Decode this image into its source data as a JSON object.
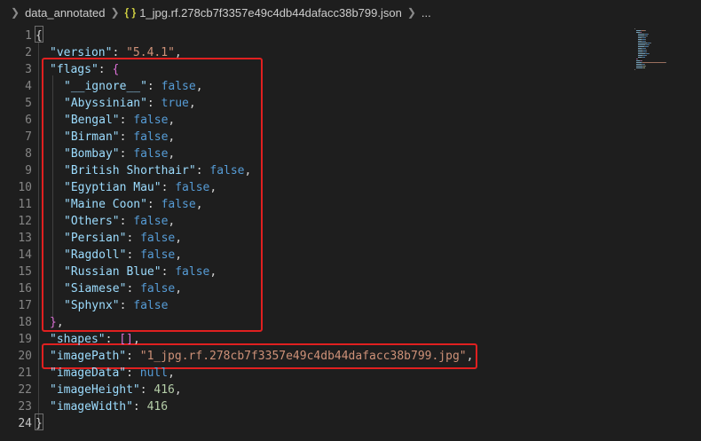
{
  "breadcrumb": {
    "folder": "data_annotated",
    "file_icon": "{ }",
    "file": "1_jpg.rf.278cb7f3357e49c4db44dafacc38b799.json",
    "more": "..."
  },
  "editor": {
    "line_numbers": [
      "1",
      "2",
      "3",
      "4",
      "5",
      "6",
      "7",
      "8",
      "9",
      "10",
      "11",
      "12",
      "13",
      "14",
      "15",
      "16",
      "17",
      "18",
      "19",
      "20",
      "21",
      "22",
      "23",
      "24"
    ],
    "active_line": "24",
    "lines": [
      [
        {
          "t": "p",
          "v": "{"
        }
      ],
      [
        {
          "t": "k",
          "v": "\"version\""
        },
        {
          "t": "p",
          "v": ": "
        },
        {
          "t": "s",
          "v": "\"5.4.1\""
        },
        {
          "t": "p",
          "v": ","
        }
      ],
      [
        {
          "t": "k",
          "v": "\"flags\""
        },
        {
          "t": "p",
          "v": ": "
        },
        {
          "t": "m",
          "v": "{"
        }
      ],
      [
        {
          "t": "k",
          "v": "\"__ignore__\""
        },
        {
          "t": "p",
          "v": ": "
        },
        {
          "t": "b",
          "v": "false"
        },
        {
          "t": "p",
          "v": ","
        }
      ],
      [
        {
          "t": "k",
          "v": "\"Abyssinian\""
        },
        {
          "t": "p",
          "v": ": "
        },
        {
          "t": "b",
          "v": "true"
        },
        {
          "t": "p",
          "v": ","
        }
      ],
      [
        {
          "t": "k",
          "v": "\"Bengal\""
        },
        {
          "t": "p",
          "v": ": "
        },
        {
          "t": "b",
          "v": "false"
        },
        {
          "t": "p",
          "v": ","
        }
      ],
      [
        {
          "t": "k",
          "v": "\"Birman\""
        },
        {
          "t": "p",
          "v": ": "
        },
        {
          "t": "b",
          "v": "false"
        },
        {
          "t": "p",
          "v": ","
        }
      ],
      [
        {
          "t": "k",
          "v": "\"Bombay\""
        },
        {
          "t": "p",
          "v": ": "
        },
        {
          "t": "b",
          "v": "false"
        },
        {
          "t": "p",
          "v": ","
        }
      ],
      [
        {
          "t": "k",
          "v": "\"British Shorthair\""
        },
        {
          "t": "p",
          "v": ": "
        },
        {
          "t": "b",
          "v": "false"
        },
        {
          "t": "p",
          "v": ","
        }
      ],
      [
        {
          "t": "k",
          "v": "\"Egyptian Mau\""
        },
        {
          "t": "p",
          "v": ": "
        },
        {
          "t": "b",
          "v": "false"
        },
        {
          "t": "p",
          "v": ","
        }
      ],
      [
        {
          "t": "k",
          "v": "\"Maine Coon\""
        },
        {
          "t": "p",
          "v": ": "
        },
        {
          "t": "b",
          "v": "false"
        },
        {
          "t": "p",
          "v": ","
        }
      ],
      [
        {
          "t": "k",
          "v": "\"Others\""
        },
        {
          "t": "p",
          "v": ": "
        },
        {
          "t": "b",
          "v": "false"
        },
        {
          "t": "p",
          "v": ","
        }
      ],
      [
        {
          "t": "k",
          "v": "\"Persian\""
        },
        {
          "t": "p",
          "v": ": "
        },
        {
          "t": "b",
          "v": "false"
        },
        {
          "t": "p",
          "v": ","
        }
      ],
      [
        {
          "t": "k",
          "v": "\"Ragdoll\""
        },
        {
          "t": "p",
          "v": ": "
        },
        {
          "t": "b",
          "v": "false"
        },
        {
          "t": "p",
          "v": ","
        }
      ],
      [
        {
          "t": "k",
          "v": "\"Russian Blue\""
        },
        {
          "t": "p",
          "v": ": "
        },
        {
          "t": "b",
          "v": "false"
        },
        {
          "t": "p",
          "v": ","
        }
      ],
      [
        {
          "t": "k",
          "v": "\"Siamese\""
        },
        {
          "t": "p",
          "v": ": "
        },
        {
          "t": "b",
          "v": "false"
        },
        {
          "t": "p",
          "v": ","
        }
      ],
      [
        {
          "t": "k",
          "v": "\"Sphynx\""
        },
        {
          "t": "p",
          "v": ": "
        },
        {
          "t": "b",
          "v": "false"
        }
      ],
      [
        {
          "t": "m",
          "v": "}"
        },
        {
          "t": "p",
          "v": ","
        }
      ],
      [
        {
          "t": "k",
          "v": "\"shapes\""
        },
        {
          "t": "p",
          "v": ": "
        },
        {
          "t": "m",
          "v": "[]"
        },
        {
          "t": "p",
          "v": ","
        }
      ],
      [
        {
          "t": "k",
          "v": "\"imagePath\""
        },
        {
          "t": "p",
          "v": ": "
        },
        {
          "t": "s",
          "v": "\"1_jpg.rf.278cb7f3357e49c4db44dafacc38b799.jpg\""
        },
        {
          "t": "p",
          "v": ","
        }
      ],
      [
        {
          "t": "k",
          "v": "\"imageData\""
        },
        {
          "t": "p",
          "v": ": "
        },
        {
          "t": "b",
          "v": "null"
        },
        {
          "t": "p",
          "v": ","
        }
      ],
      [
        {
          "t": "k",
          "v": "\"imageHeight\""
        },
        {
          "t": "p",
          "v": ": "
        },
        {
          "t": "n",
          "v": "416"
        },
        {
          "t": "p",
          "v": ","
        }
      ],
      [
        {
          "t": "k",
          "v": "\"imageWidth\""
        },
        {
          "t": "p",
          "v": ": "
        },
        {
          "t": "n",
          "v": "416"
        }
      ],
      [
        {
          "t": "p",
          "v": "}"
        }
      ]
    ]
  },
  "colors": {
    "background": "#1e1e1e",
    "key": "#9cdcfe",
    "string": "#ce9178",
    "keyword": "#569cd6",
    "number": "#b5cea8",
    "highlight_box": "#e02020"
  }
}
